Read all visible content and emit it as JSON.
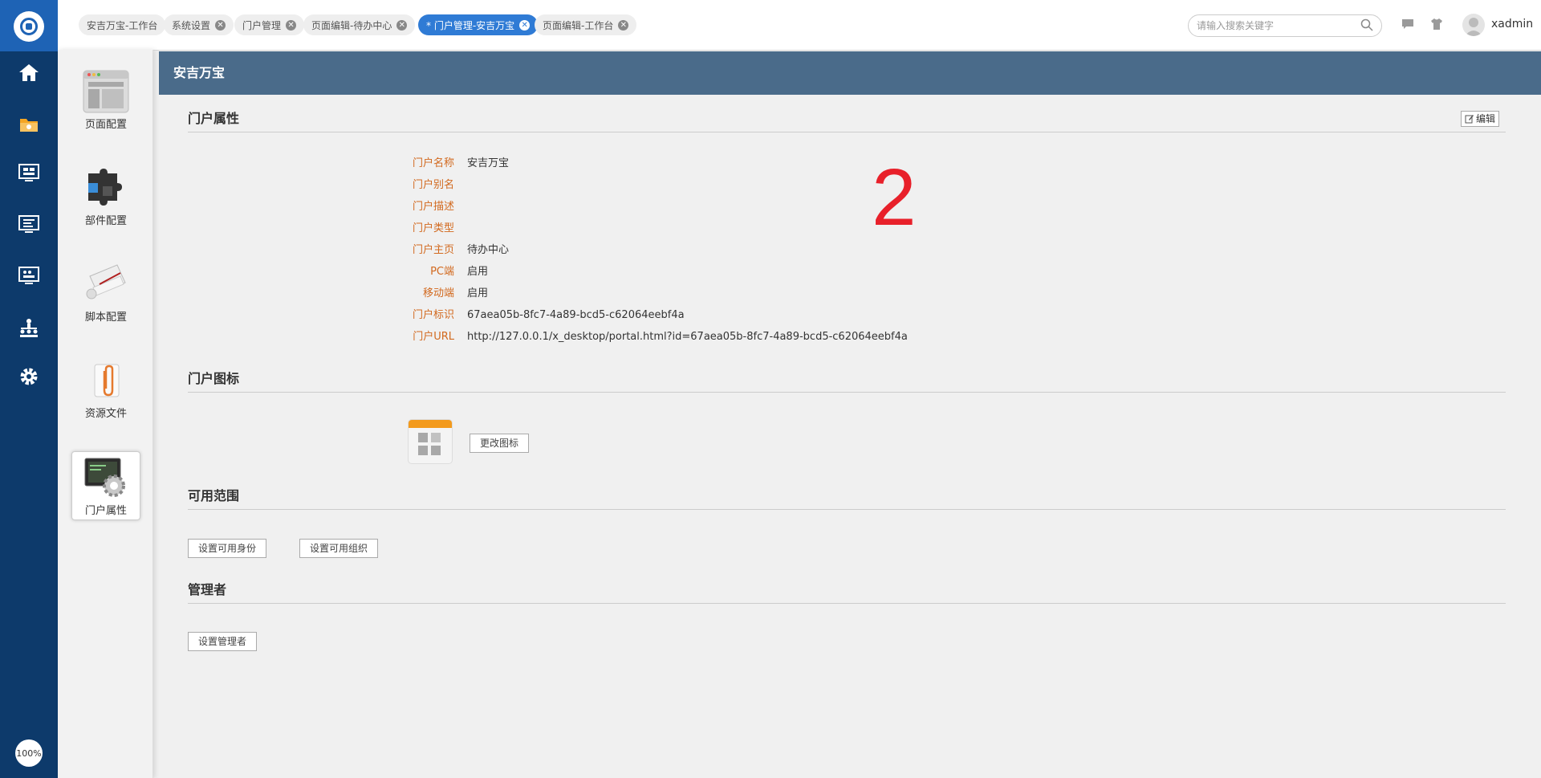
{
  "leftnav": {
    "items": [
      "home-icon",
      "folder-icon",
      "dashboard-icon",
      "monitor-icon",
      "screen-icon",
      "org-icon",
      "settings-icon"
    ],
    "zoom": "100%"
  },
  "topbar": {
    "tabs": [
      {
        "label": "安吉万宝-工作台"
      },
      {
        "label": "系统设置"
      },
      {
        "label": "门户管理"
      },
      {
        "label": "页面编辑-待办中心"
      },
      {
        "label": "* 门户管理-安吉万宝"
      },
      {
        "label": "页面编辑-工作台"
      }
    ],
    "close_glyph": "✕",
    "search_placeholder": "请输入搜索关键字",
    "username": "xadmin"
  },
  "sidepanel": {
    "items": [
      {
        "label": "页面配置"
      },
      {
        "label": "部件配置"
      },
      {
        "label": "脚本配置"
      },
      {
        "label": "资源文件"
      },
      {
        "label": "门户属性"
      }
    ]
  },
  "main": {
    "title": "安吉万宝",
    "attrs_title": "门户属性",
    "edit_label": "编辑",
    "marker": "2",
    "props": [
      {
        "k": "门户名称",
        "v": "安吉万宝"
      },
      {
        "k": "门户别名",
        "v": ""
      },
      {
        "k": "门户描述",
        "v": ""
      },
      {
        "k": "门户类型",
        "v": ""
      },
      {
        "k": "门户主页",
        "v": "待办中心"
      },
      {
        "k": "PC端",
        "v": "启用"
      },
      {
        "k": "移动端",
        "v": "启用"
      },
      {
        "k": "门户标识",
        "v": "67aea05b-8fc7-4a89-bcd5-c62064eebf4a"
      },
      {
        "k": "门户URL",
        "v": "http://127.0.0.1/x_desktop/portal.html?id=67aea05b-8fc7-4a89-bcd5-c62064eebf4a"
      }
    ],
    "icon_title": "门户图标",
    "change_icon_label": "更改图标",
    "scope_title": "可用范围",
    "set_identity_label": "设置可用身份",
    "set_org_label": "设置可用组织",
    "admin_title": "管理者",
    "set_admin_label": "设置管理者"
  }
}
